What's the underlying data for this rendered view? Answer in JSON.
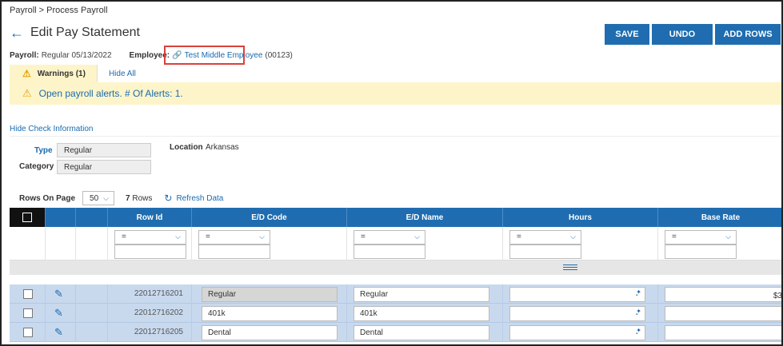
{
  "breadcrumb": "Payroll > Process Payroll",
  "title": "Edit Pay Statement",
  "actions": {
    "save": "SAVE",
    "undo": "UNDO",
    "add_rows": "ADD ROWS"
  },
  "meta": {
    "payroll_label": "Payroll:",
    "payroll_value": "Regular 05/13/2022",
    "employee_label": "Employee:",
    "employee_name": "Test Middle Employee",
    "employee_id": "(00123)"
  },
  "tabs": {
    "warnings": "Warnings (1)",
    "hide_all": "Hide All"
  },
  "alert": {
    "text": "Open payroll alerts. # Of Alerts: 1."
  },
  "hide_check": "Hide Check Information",
  "check_info": {
    "type_label": "Type",
    "type_value": "Regular",
    "category_label": "Category",
    "category_value": "Regular",
    "location_label": "Location",
    "location_value": "Arkansas"
  },
  "toolbar": {
    "rows_on_page_label": "Rows On Page",
    "rows_on_page_value": "50",
    "rows_count": "7",
    "rows_word": "Rows",
    "refresh": "Refresh Data"
  },
  "columns": {
    "row_id": "Row Id",
    "ed_code": "E/D Code",
    "ed_name": "E/D Name",
    "hours": "Hours",
    "base_rate": "Base Rate"
  },
  "filter_op": "=",
  "rows": [
    {
      "row_id": "22012716201",
      "code": "Regular",
      "name": "Regular",
      "hours": "-",
      "rate": "$3"
    },
    {
      "row_id": "22012716202",
      "code": "401k",
      "name": "401k",
      "hours": "-",
      "rate": ""
    },
    {
      "row_id": "22012716205",
      "code": "Dental",
      "name": "Dental",
      "hours": "-",
      "rate": ""
    }
  ],
  "colors": {
    "accent": "#1f6db0",
    "warning_bg": "#fdf5c9",
    "row_bg": "#c8d9ee",
    "highlight_box": "#d9413a"
  }
}
